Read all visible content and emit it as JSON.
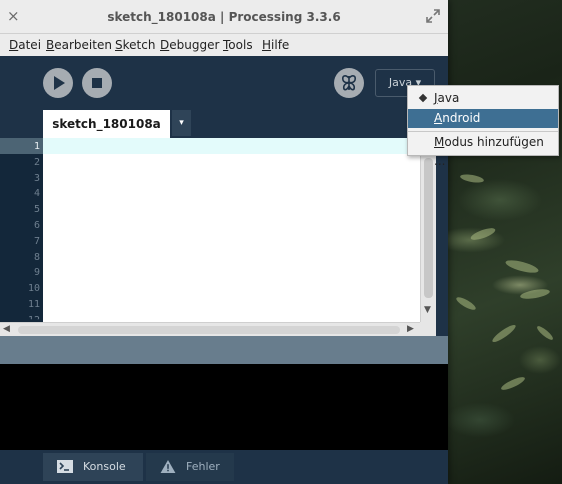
{
  "window": {
    "title": "sketch_180108a | Processing 3.3.6",
    "close_glyph": "×"
  },
  "menubar": {
    "items": [
      {
        "label": "Datei",
        "mnemonic": "D",
        "rest": "atei"
      },
      {
        "label": "Bearbeiten",
        "mnemonic": "B",
        "rest": "earbeiten"
      },
      {
        "label": "Sketch",
        "mnemonic": "S",
        "rest": "ketch"
      },
      {
        "label": "Debugger",
        "mnemonic": "D",
        "rest": "ebugger"
      },
      {
        "label": "Tools",
        "mnemonic": "T",
        "rest": "ools"
      },
      {
        "label": "Hilfe",
        "mnemonic": "H",
        "rest": "ilfe"
      }
    ]
  },
  "toolbar": {
    "run_icon": "play-icon",
    "stop_icon": "stop-icon",
    "debug_icon": "butterfly-icon",
    "mode_label": "Java ▾"
  },
  "tabs": {
    "sketch_name": "sketch_180108a",
    "menu_glyph": "▾"
  },
  "editor": {
    "line_numbers": [
      "1",
      "2",
      "3",
      "4",
      "5",
      "6",
      "7",
      "8",
      "9",
      "10",
      "11",
      "12"
    ],
    "current_line": 1
  },
  "bottom_tabs": {
    "console_label": "Konsole",
    "errors_label": "Fehler"
  },
  "mode_menu": {
    "items": [
      {
        "mnemonic": "J",
        "rest": "ava",
        "selected": true,
        "highlighted": false
      },
      {
        "mnemonic": "A",
        "rest": "ndroid",
        "selected": false,
        "highlighted": true
      },
      {
        "mnemonic": "M",
        "rest": "odus hinzufügen ...",
        "selected": false,
        "highlighted": false
      }
    ]
  },
  "colors": {
    "toolbar_bg": "#1e3247",
    "menu_highlight": "#3e6f93",
    "current_line": "#e3fbfb"
  }
}
